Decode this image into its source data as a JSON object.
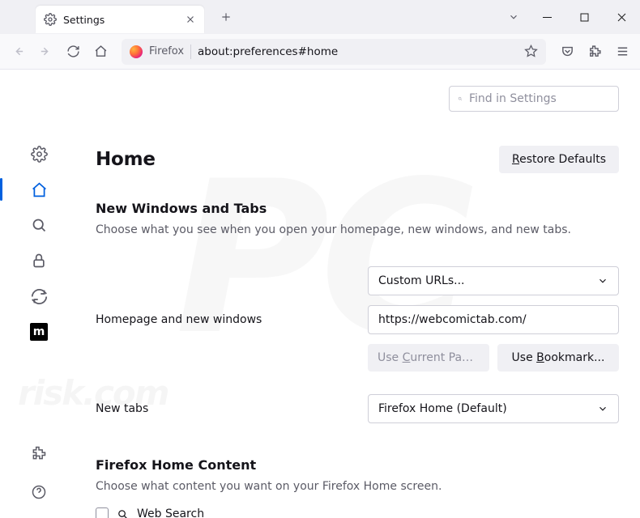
{
  "tab": {
    "title": "Settings"
  },
  "urlbar": {
    "label": "Firefox",
    "url": "about:preferences#home"
  },
  "search": {
    "placeholder": "Find in Settings"
  },
  "page": {
    "title": "Home",
    "restore": "estore Defaults",
    "restore_prefix": "R"
  },
  "section1": {
    "title": "New Windows and Tabs",
    "desc": "Choose what you see when you open your homepage, new windows, and new tabs.",
    "homepage_label": "Homepage and new windows",
    "homepage_select": "Custom URLs...",
    "homepage_value": "https://webcomictab.com/",
    "use_current_prefix": "Use ",
    "use_current_ul": "C",
    "use_current_rest": "urrent Pages",
    "use_bookmark_prefix": "Use ",
    "use_bookmark_ul": "B",
    "use_bookmark_rest": "ookmark...",
    "newtabs_label": "New tabs",
    "newtabs_select": "Firefox Home (Default)"
  },
  "section2": {
    "title": "Firefox Home Content",
    "desc": "Choose what content you want on your Firefox Home screen.",
    "web_search": "Web Search"
  }
}
